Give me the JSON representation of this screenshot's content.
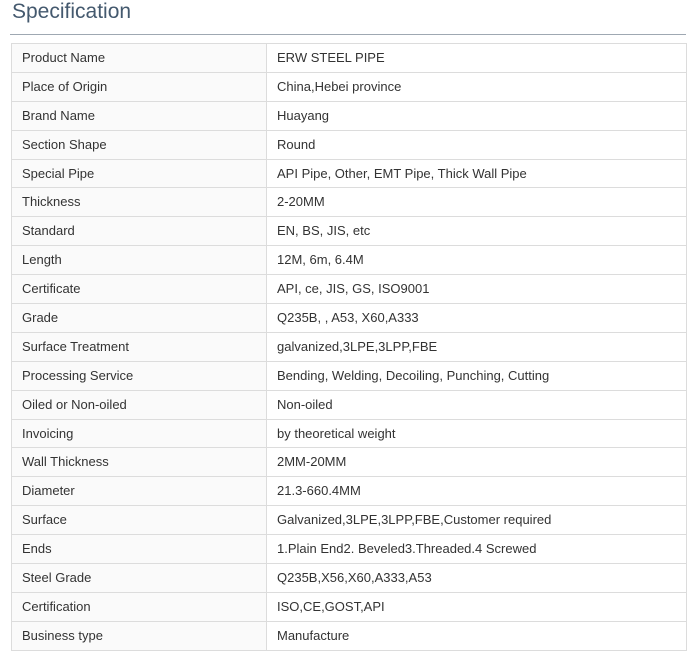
{
  "section": {
    "title": "Specification"
  },
  "specs": [
    {
      "label": "Product Name",
      "value": "ERW STEEL PIPE"
    },
    {
      "label": "Place of Origin",
      "value": "China,Hebei province"
    },
    {
      "label": "Brand Name",
      "value": "Huayang"
    },
    {
      "label": "Section Shape",
      "value": "Round"
    },
    {
      "label": "Special Pipe",
      "value": "API Pipe, Other, EMT Pipe, Thick Wall Pipe"
    },
    {
      "label": "Thickness",
      "value": "2-20MM"
    },
    {
      "label": "Standard",
      "value": "EN, BS, JIS, etc"
    },
    {
      "label": "Length",
      "value": "12M, 6m, 6.4M"
    },
    {
      "label": "Certificate",
      "value": "API, ce, JIS, GS, ISO9001"
    },
    {
      "label": "Grade",
      "value": "Q235B, , A53, X60,A333"
    },
    {
      "label": "Surface Treatment",
      "value": "galvanized,3LPE,3LPP,FBE"
    },
    {
      "label": "Processing Service",
      "value": "Bending, Welding, Decoiling, Punching, Cutting"
    },
    {
      "label": "Oiled or Non-oiled",
      "value": "Non-oiled"
    },
    {
      "label": "Invoicing",
      "value": "by theoretical weight"
    },
    {
      "label": "Wall Thickness",
      "value": "2MM-20MM"
    },
    {
      "label": "Diameter",
      "value": "21.3-660.4MM"
    },
    {
      "label": "Surface",
      "value": "Galvanized,3LPE,3LPP,FBE,Customer required"
    },
    {
      "label": "Ends",
      "value": "1.Plain End2. Beveled3.Threaded.4 Screwed"
    },
    {
      "label": "Steel Grade",
      "value": "Q235B,X56,X60,A333,A53"
    },
    {
      "label": "Certification",
      "value": "ISO,CE,GOST,API"
    },
    {
      "label": "Business type",
      "value": "Manufacture"
    }
  ]
}
